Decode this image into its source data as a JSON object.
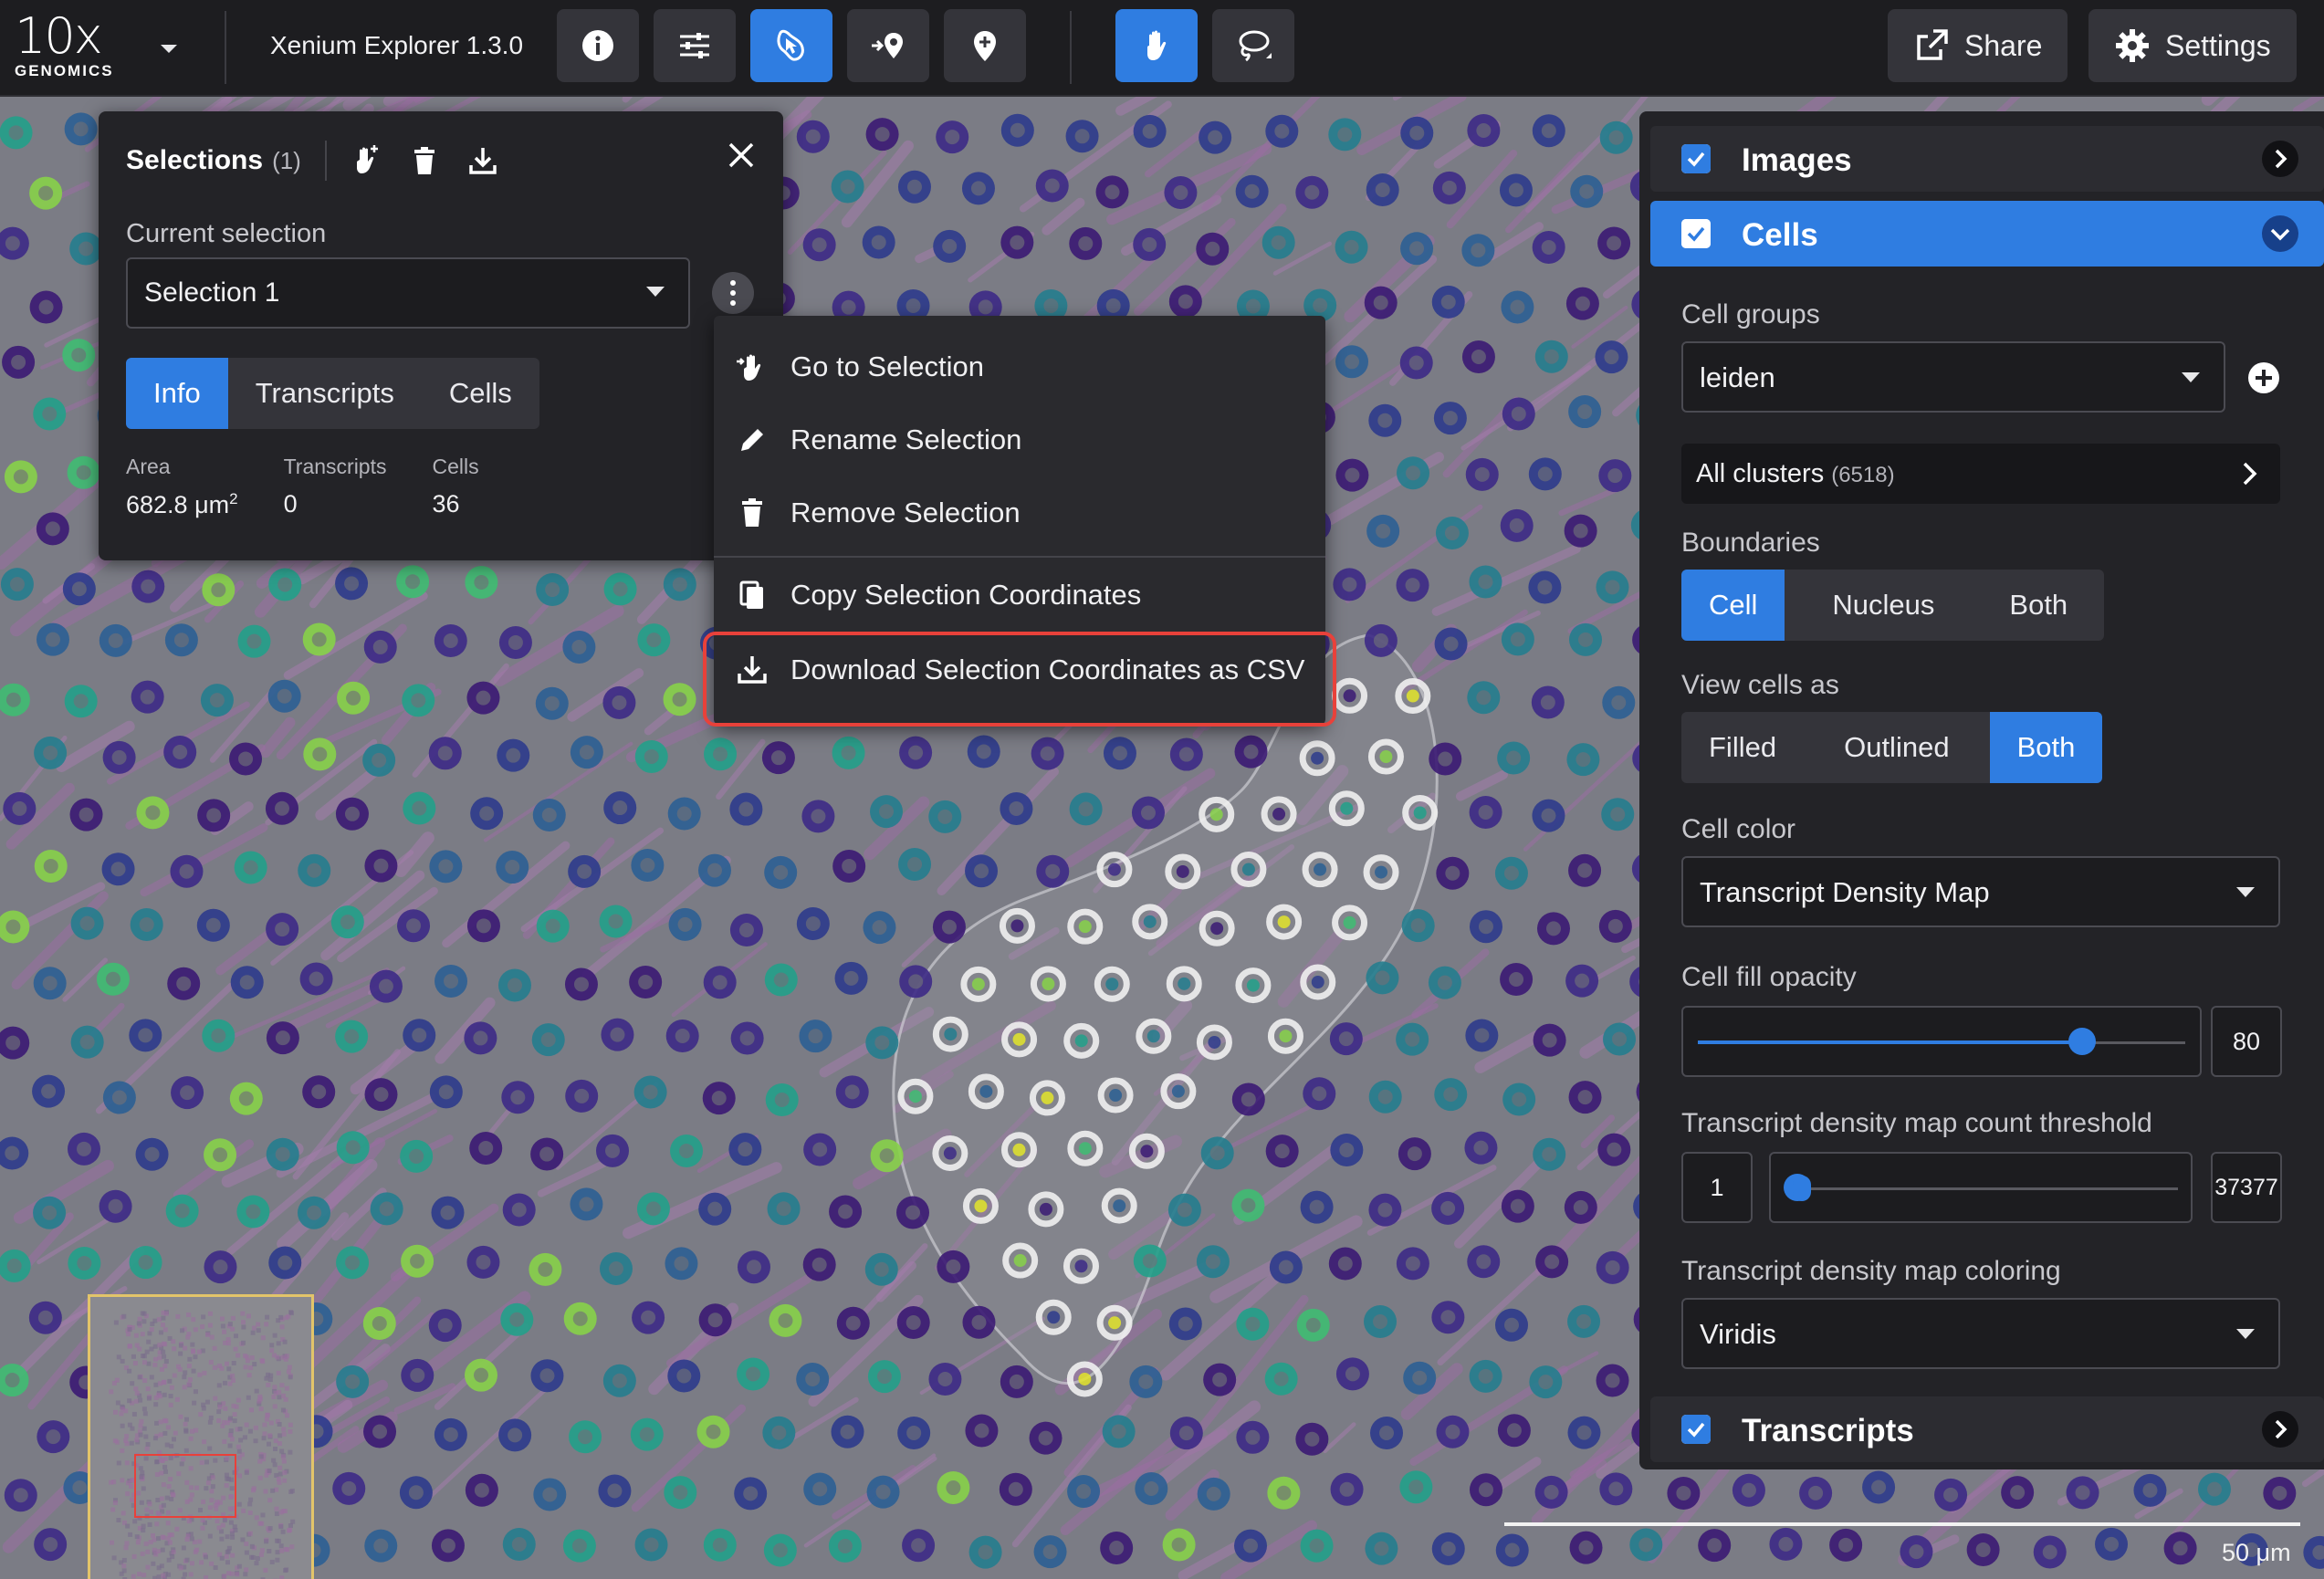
{
  "topbar": {
    "logo_big": "10x",
    "logo_small": "GENOMICS",
    "app_title": "Xenium Explorer 1.3.0",
    "share_label": "Share",
    "settings_label": "Settings"
  },
  "selections_panel": {
    "title": "Selections",
    "count": "(1)",
    "current_selection_label": "Current selection",
    "current_selection_value": "Selection 1",
    "tabs": [
      "Info",
      "Transcripts",
      "Cells"
    ],
    "active_tab": "Info",
    "stats": {
      "area_label": "Area",
      "area_value": "682.8 μm",
      "area_sup": "2",
      "transcripts_label": "Transcripts",
      "transcripts_value": "0",
      "cells_label": "Cells",
      "cells_value": "36"
    }
  },
  "context_menu": {
    "items": [
      {
        "label": "Go to Selection",
        "icon": "go-to-icon"
      },
      {
        "label": "Rename Selection",
        "icon": "pencil-icon"
      },
      {
        "label": "Remove Selection",
        "icon": "trash-icon"
      },
      {
        "label": "Copy Selection Coordinates",
        "icon": "copy-icon"
      },
      {
        "label": "Download Selection Coordinates as CSV",
        "icon": "download-icon"
      }
    ],
    "highlighted_item": "Download Selection Coordinates as CSV"
  },
  "right_panel": {
    "images_label": "Images",
    "cells_label": "Cells",
    "cell_groups_label": "Cell groups",
    "cell_groups_value": "leiden",
    "all_clusters_label": "All clusters",
    "all_clusters_count": "(6518)",
    "boundaries_label": "Boundaries",
    "boundaries_options": [
      "Cell",
      "Nucleus",
      "Both"
    ],
    "boundaries_selected": "Cell",
    "view_cells_label": "View cells as",
    "view_cells_options": [
      "Filled",
      "Outlined",
      "Both"
    ],
    "view_cells_selected": "Both",
    "cell_color_label": "Cell color",
    "cell_color_value": "Transcript Density Map",
    "cell_fill_opacity_label": "Cell fill opacity",
    "cell_fill_opacity_value": "80",
    "threshold_label": "Transcript density map count threshold",
    "threshold_min": "1",
    "threshold_max": "37377",
    "coloring_label": "Transcript density map coloring",
    "coloring_value": "Viridis",
    "transcripts_label": "Transcripts"
  },
  "scale": {
    "label": "50 μm"
  },
  "colors": {
    "accent": "#2f7de1",
    "highlight": "#e8413a",
    "panel_bg": "#232327"
  }
}
